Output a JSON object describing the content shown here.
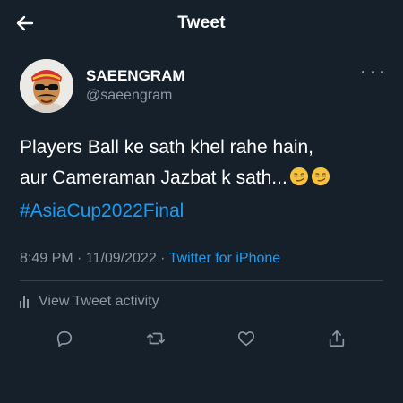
{
  "header": {
    "title": "Tweet",
    "back_icon": "arrow-left-icon"
  },
  "author": {
    "display_name": "SAEENGRAM",
    "handle": "@saeengram",
    "more_icon": "more-horizontal-icon"
  },
  "tweet": {
    "line1": "Players Ball ke sath khel rahe hain,",
    "line2": "aur Cameraman Jazbat k sath...",
    "emojis": [
      "smirking-face-icon",
      "smirking-face-icon"
    ],
    "hashtag": "#AsiaCup2022Final"
  },
  "meta": {
    "time": "8:49 PM",
    "separator": "·",
    "date": "11/09/2022",
    "source": "Twitter for iPhone"
  },
  "activity": {
    "label": "View Tweet activity",
    "icon": "bar-chart-icon"
  },
  "actions": [
    "reply-icon",
    "retweet-icon",
    "like-icon",
    "share-icon"
  ],
  "colors": {
    "background": "#15202b",
    "accent": "#1d9bf0",
    "secondary_text": "#8b98a5",
    "divider": "#38444d"
  }
}
